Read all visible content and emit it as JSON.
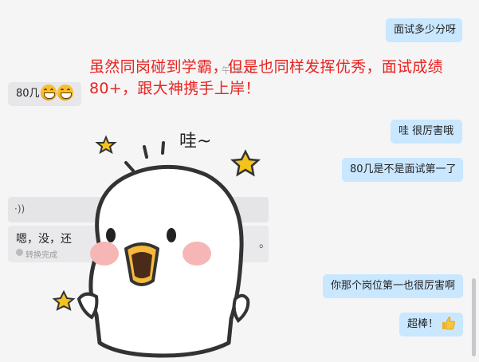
{
  "messages": {
    "m1": "面试多少分呀",
    "m2": "80几",
    "m3": "哇  很厉害哦",
    "m4": "80几是不是面试第一了",
    "m5": "你那个岗位第一也很厉害啊",
    "m6": "超棒！"
  },
  "timestamp": "午09:55",
  "voice": {
    "icon": "voice-wave-icon",
    "transcript": "嗯，没，还",
    "status": "转换完成",
    "trailing": "。"
  },
  "caption": "虽然同岗碰到学霸，但是也同样发挥优秀，面试成绩80+，跟大神携手上岸！",
  "sticker": {
    "text": "哇~"
  },
  "colors": {
    "my_bubble": "#c9e7ff",
    "their_bubble": "#e7e7ea",
    "caption": "#e8231f",
    "star": "#f4c21b"
  }
}
